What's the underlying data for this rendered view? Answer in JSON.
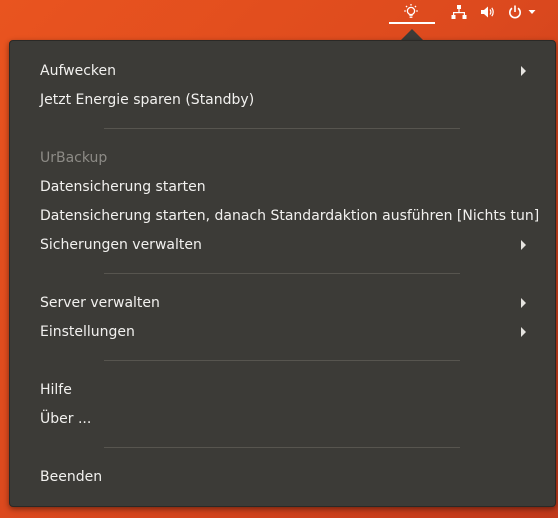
{
  "tray": {
    "icons": [
      "lightbulb-icon",
      "network-icon",
      "volume-icon",
      "power-icon",
      "chevron-down-icon"
    ]
  },
  "menu": {
    "items": [
      {
        "label": "Aufwecken"
      },
      {
        "label": "Jetzt Energie sparen (Standby)"
      },
      {
        "label": "UrBackup"
      },
      {
        "label": "Datensicherung starten"
      },
      {
        "label": "Datensicherung starten, danach Standardaktion ausführen [Nichts tun]"
      },
      {
        "label": "Sicherungen verwalten"
      },
      {
        "label": "Server verwalten"
      },
      {
        "label": "Einstellungen"
      },
      {
        "label": "Hilfe"
      },
      {
        "label": "Über ..."
      },
      {
        "label": "Beenden"
      }
    ]
  }
}
